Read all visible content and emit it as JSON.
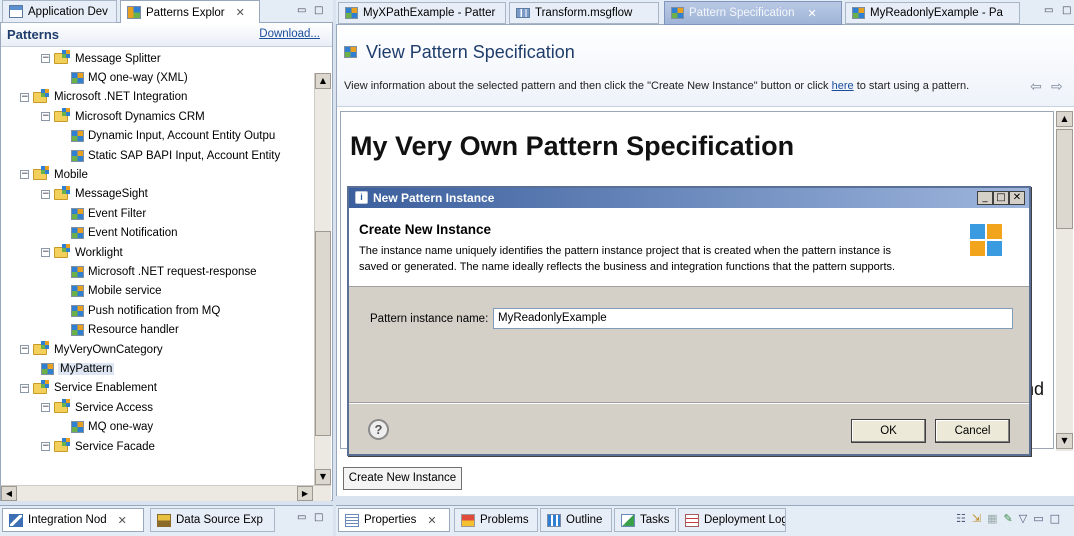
{
  "left_tabs": {
    "app_dev": "Application Dev",
    "patterns": "Patterns Explor"
  },
  "patterns_panel": {
    "title": "Patterns",
    "download": "Download...",
    "tree": [
      {
        "label": "Message Splitter",
        "icon": "folder-icon",
        "exp": "⊟"
      },
      {
        "label": "MQ one-way (XML)",
        "icon": "pattern-icon",
        "exp": ""
      },
      {
        "label": "Microsoft .NET Integration",
        "icon": "folder-icon",
        "exp": "⊟"
      },
      {
        "label": "Microsoft Dynamics CRM",
        "icon": "folder-icon",
        "exp": "⊟"
      },
      {
        "label": "Dynamic Input, Account Entity Outpu",
        "icon": "pattern-icon",
        "exp": ""
      },
      {
        "label": "Static SAP BAPI Input, Account Entity",
        "icon": "pattern-icon",
        "exp": ""
      },
      {
        "label": "Mobile",
        "icon": "folder-icon",
        "exp": "⊟"
      },
      {
        "label": "MessageSight",
        "icon": "folder-icon",
        "exp": "⊟"
      },
      {
        "label": "Event Filter",
        "icon": "pattern-icon",
        "exp": ""
      },
      {
        "label": "Event Notification",
        "icon": "pattern-icon",
        "exp": ""
      },
      {
        "label": "Worklight",
        "icon": "folder-icon",
        "exp": "⊟"
      },
      {
        "label": "Microsoft .NET request-response",
        "icon": "pattern-icon",
        "exp": ""
      },
      {
        "label": "Mobile service",
        "icon": "pattern-icon",
        "exp": ""
      },
      {
        "label": "Push notification from MQ",
        "icon": "pattern-icon",
        "exp": ""
      },
      {
        "label": "Resource handler",
        "icon": "pattern-icon",
        "exp": ""
      },
      {
        "label": "MyVeryOwnCategory",
        "icon": "folder-icon",
        "exp": "⊟"
      },
      {
        "label": "MyPattern",
        "icon": "pattern-icon",
        "exp": ""
      },
      {
        "label": "Service Enablement",
        "icon": "folder-icon",
        "exp": "⊟"
      },
      {
        "label": "Service Access",
        "icon": "folder-icon",
        "exp": "⊟"
      },
      {
        "label": "MQ one-way",
        "icon": "pattern-icon",
        "exp": ""
      },
      {
        "label": "Service Facade",
        "icon": "folder-icon",
        "exp": "⊟"
      }
    ]
  },
  "bottom_left_tabs": {
    "integration": "Integration Nod",
    "datasource": "Data Source Exp"
  },
  "editor_tabs": [
    "MyXPathExample - Patter",
    "Transform.msgflow",
    "Pattern Specification",
    "MyReadonlyExample - Pa"
  ],
  "spec": {
    "header": "View Pattern Specification",
    "info_pre": "View information about the selected pattern and then click the \"Create New Instance\" button or click ",
    "info_link": "here",
    "info_post": " to start using a pattern.",
    "title": "My Very Own Pattern Specification",
    "clipped_text": "nd",
    "create_button": "Create New Instance"
  },
  "dialog": {
    "title": "New Pattern Instance",
    "heading": "Create New Instance",
    "desc_line1": "The instance name uniquely identifies the pattern instance project that is created when the pattern instance is",
    "desc_line2": "saved or generated.  The name ideally reflects the business and integration functions that the pattern supports.",
    "field_label": "Pattern instance name:",
    "field_value": "MyReadonlyExample",
    "ok": "OK",
    "cancel": "Cancel",
    "help": "?"
  },
  "bottom_tabs": [
    "Properties",
    "Problems",
    "Outline",
    "Tasks",
    "Deployment Log"
  ]
}
